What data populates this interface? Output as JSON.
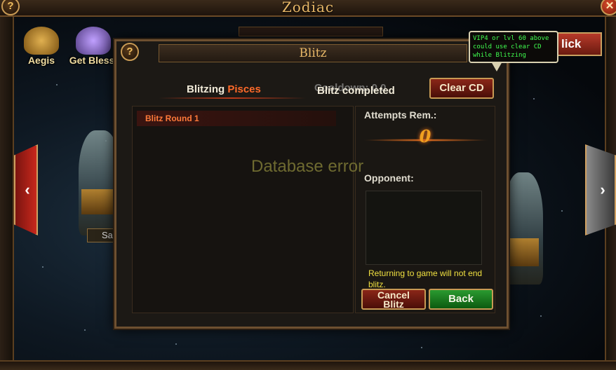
{
  "window": {
    "title": "Zodiac",
    "help_symbol": "?",
    "close_symbol": "✕"
  },
  "background": {
    "features": [
      {
        "label": "Aegis",
        "icon": "winged-emblem-icon"
      },
      {
        "label": "Get Blessi",
        "icon": "crystal-emblem-icon"
      }
    ],
    "left_arrow": "‹",
    "right_arrow": "›",
    "small_tag": "Sa",
    "partial_button": "lick"
  },
  "dialog": {
    "title": "Blitz",
    "help_symbol": "?",
    "blitzing_label": "Blitzing",
    "blitz_target": "Pisces",
    "cooldown_label": "Cooldown: 0 0",
    "completed_label": "Blitz completed",
    "clear_cd_label": "Clear CD",
    "rounds": [
      {
        "label": "Blitz Round 1"
      }
    ],
    "attempts_label": "Attempts Rem.:",
    "attempts_value": "0",
    "opponent_label": "Opponent:",
    "notice": "Returning to game will not end blitz.",
    "cancel_label_line1": "Cancel",
    "cancel_label_line2": "Blitz",
    "back_label": "Back"
  },
  "error_text": "Database error",
  "tooltip": {
    "text": "VIP4 or lvl 60 above could use clear CD while Blitzing"
  },
  "colors": {
    "accent_orange": "#ff6a2a",
    "title_gold": "#e8b868",
    "notice_yellow": "#f0e040",
    "tooltip_green": "#40ff50"
  }
}
